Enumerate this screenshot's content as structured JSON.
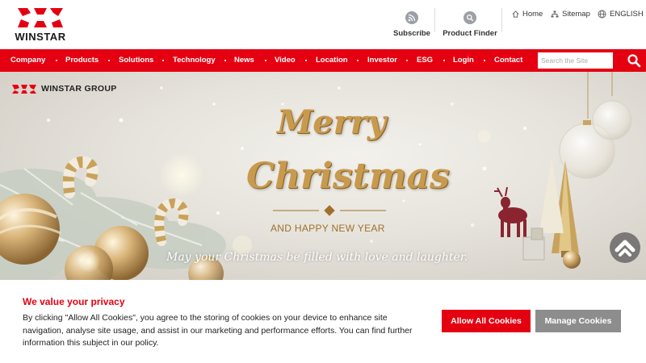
{
  "brand": {
    "name": "WINSTAR",
    "group_name": "WINSTAR GROUP",
    "accent_color": "#e50011"
  },
  "utility": {
    "subscribe": {
      "label": "Subscribe",
      "icon": "rss-icon"
    },
    "product_finder": {
      "label": "Product Finder",
      "icon": "product-search-icon"
    },
    "home": {
      "label": "Home",
      "icon": "home-icon"
    },
    "sitemap": {
      "label": "Sitemap",
      "icon": "sitemap-icon"
    },
    "language": {
      "label": "ENGLISH",
      "icon": "globe-icon"
    }
  },
  "nav": {
    "items": [
      {
        "label": "Company"
      },
      {
        "label": "Products"
      },
      {
        "label": "Solutions"
      },
      {
        "label": "Technology"
      },
      {
        "label": "News"
      },
      {
        "label": "Video"
      },
      {
        "label": "Location"
      },
      {
        "label": "Investor"
      },
      {
        "label": "ESG"
      },
      {
        "label": "Login"
      },
      {
        "label": "Contact"
      }
    ],
    "search_placeholder": "Search the Site",
    "search_value": ""
  },
  "hero": {
    "line1": "Merry",
    "line2": "Christmas",
    "line3": "AND HAPPY NEW YEAR",
    "line4": "May your Christmas be filled with love and laughter."
  },
  "cookie": {
    "title": "We value your privacy",
    "text": "By clicking \"Allow All Cookies\", you agree to the storing of cookies on your device to enhance site navigation, analyse site usage, and assist in our marketing and performance efforts. You can find further information this subject in our policy.",
    "allow_label": "Allow All Cookies",
    "manage_label": "Manage Cookies"
  }
}
